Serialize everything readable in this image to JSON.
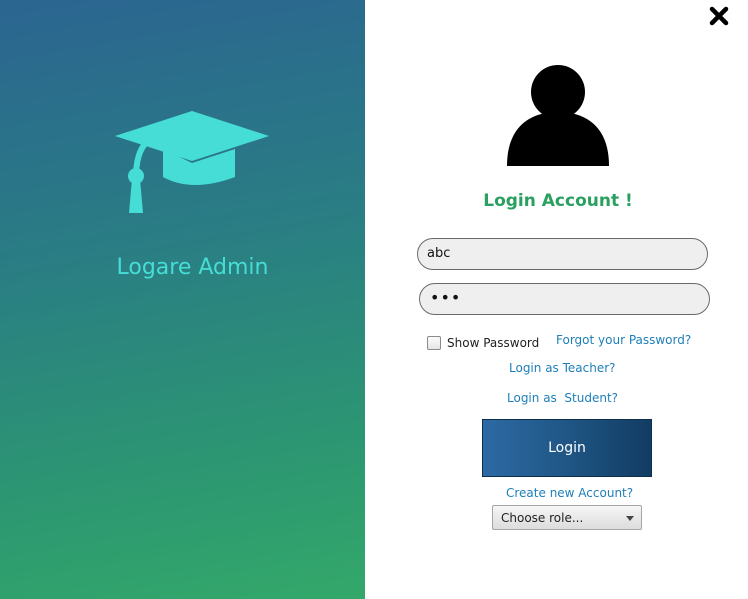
{
  "brand": {
    "title": "Logare Admin",
    "icon": "graduation-cap-icon",
    "accent_color": "#47ddd7"
  },
  "login": {
    "avatar_icon": "user-icon",
    "heading": "Login Account !",
    "heading_color": "#2aa060",
    "username_value": "abc",
    "password_value": "•••",
    "show_password_label": "Show Password",
    "show_password_checked": false,
    "forgot_link": "Forgot your Password?",
    "teacher_link": "Login as Teacher?",
    "student_link": "Login as  Student?",
    "login_button": "Login",
    "create_account_link": "Create new Account?",
    "role_select_value": "Choose role...",
    "link_color": "#1e7fb8"
  },
  "window": {
    "close_icon": "close-icon"
  }
}
